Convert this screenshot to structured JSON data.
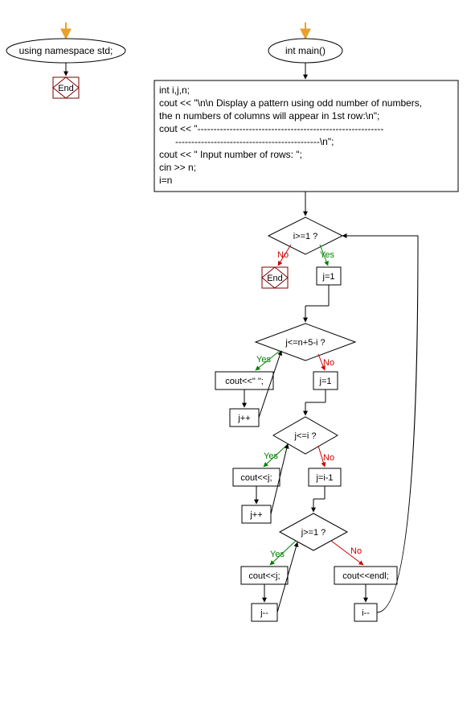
{
  "nodes": {
    "ns_label": "using namespace std;",
    "end1": "End",
    "main_label": "int main()",
    "code_block": {
      "l1": "int i,j,n;",
      "l2": "cout << \"\\n\\n Display a pattern using odd number of numbers,",
      "l3": "the n numbers of columns will appear in 1st row:\\n\";",
      "l4": "cout << \"----------------------------------------------------------",
      "l5": "---------------------------------------------\\n\";",
      "l6": "cout << \" Input number of rows: \";",
      "l7": "cin >> n;",
      "l8": "i=n"
    },
    "cond1": "i>=1 ?",
    "end2": "End",
    "assign_j1": "j=1",
    "cond2": "j<=n+5-i ?",
    "cout_space": "cout<<\" \";",
    "jpp1": "j++",
    "assign_j1b": "j=1",
    "cond3": "j<=i ?",
    "cout_j1": "cout<<j;",
    "jpp2": "j++",
    "assign_ji": "j=i-1",
    "cond4": "j>=1 ?",
    "cout_j2": "cout<<j;",
    "jmm1": "j--",
    "cout_endl": "cout<<endl;",
    "imm": "i--"
  },
  "labels": {
    "yes": "Yes",
    "no": "No"
  },
  "entry_arrow_color": "#e8a02a"
}
